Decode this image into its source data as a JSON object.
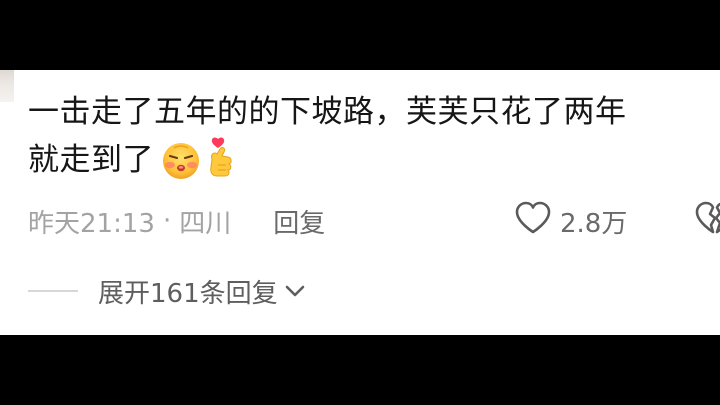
{
  "comment": {
    "text_line1": "一击走了五年的的下坡路，芙芙只花了两年",
    "text_line2": "就走到了",
    "emojis": [
      "pouting-face-icon",
      "finger-heart-icon"
    ]
  },
  "meta": {
    "time": "昨天21:13",
    "separator": "·",
    "location": "四川",
    "reply_label": "回复",
    "like_count": "2.8万"
  },
  "replies": {
    "expand_label": "展开161条回复"
  },
  "colors": {
    "background": "#000000",
    "panel": "#ffffff",
    "text_primary": "#161616",
    "text_secondary": "#a3a3a3",
    "action": "#6a6a6a"
  }
}
